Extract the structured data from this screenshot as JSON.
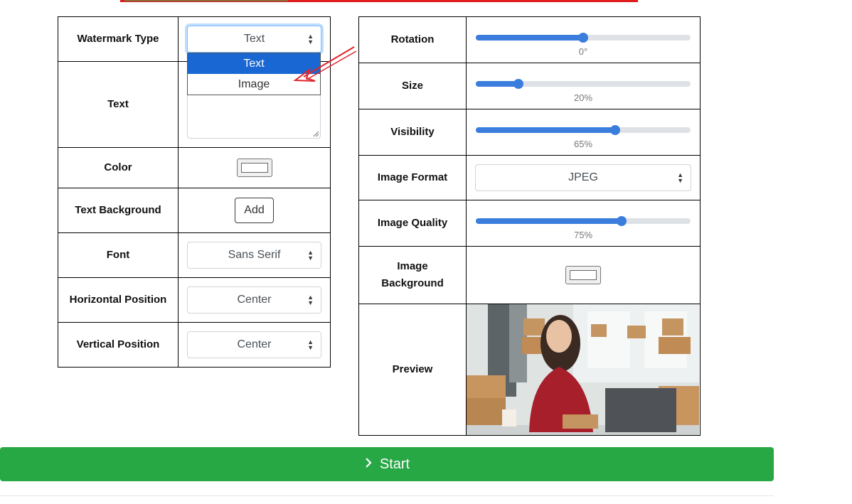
{
  "left_panel": {
    "watermark_type": {
      "label": "Watermark Type",
      "value": "Text",
      "options": [
        "Text",
        "Image"
      ],
      "selected_option": "Text"
    },
    "text": {
      "label": "Text",
      "value": ""
    },
    "color": {
      "label": "Color",
      "value": "#ffffff"
    },
    "text_background": {
      "label": "Text Background",
      "button": "Add"
    },
    "font": {
      "label": "Font",
      "value": "Sans Serif"
    },
    "horizontal_position": {
      "label": "Horizontal Position",
      "value": "Center"
    },
    "vertical_position": {
      "label": "Vertical Position",
      "value": "Center"
    }
  },
  "right_panel": {
    "rotation": {
      "label": "Rotation",
      "value": "0°",
      "fraction": 0.5
    },
    "size": {
      "label": "Size",
      "value": "20%",
      "fraction": 0.2
    },
    "visibility": {
      "label": "Visibility",
      "value": "65%",
      "fraction": 0.65
    },
    "image_format": {
      "label": "Image Format",
      "value": "JPEG"
    },
    "image_quality": {
      "label": "Image Quality",
      "value": "75%",
      "fraction": 0.68
    },
    "image_background": {
      "label_line1": "Image",
      "label_line2": "Background",
      "value": "#ffffff"
    },
    "preview": {
      "label": "Preview"
    }
  },
  "start_button": {
    "label": "Start",
    "icon": "chevron-right-icon"
  },
  "colors": {
    "accent": "#3b7ddd",
    "start": "#28a745",
    "dropdown_selected": "#1967d2",
    "annotation_arrow": "#e0242b"
  }
}
